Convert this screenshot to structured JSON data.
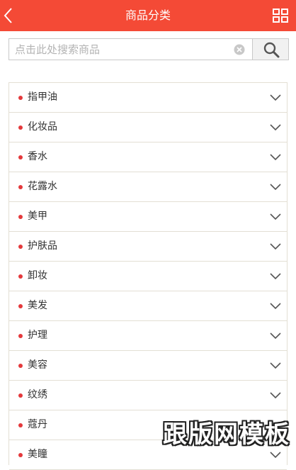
{
  "header": {
    "title": "商品分类",
    "back_icon": "chevron-left-icon",
    "menu_icon": "grid-icon",
    "background_color": "#f44a36"
  },
  "search": {
    "placeholder": "点击此处搜索商品",
    "value": "",
    "clear_icon": "clear-icon",
    "button_icon": "search-icon"
  },
  "categories": [
    {
      "label": "指甲油"
    },
    {
      "label": "化妆品"
    },
    {
      "label": "香水"
    },
    {
      "label": "花露水"
    },
    {
      "label": "美甲"
    },
    {
      "label": "护肤品"
    },
    {
      "label": "卸妆"
    },
    {
      "label": "美发"
    },
    {
      "label": "护理"
    },
    {
      "label": "美容"
    },
    {
      "label": "纹绣"
    },
    {
      "label": "蔻丹"
    },
    {
      "label": "美瞳"
    }
  ],
  "bullet_color": "#e4393c",
  "watermark": "跟版网模板"
}
